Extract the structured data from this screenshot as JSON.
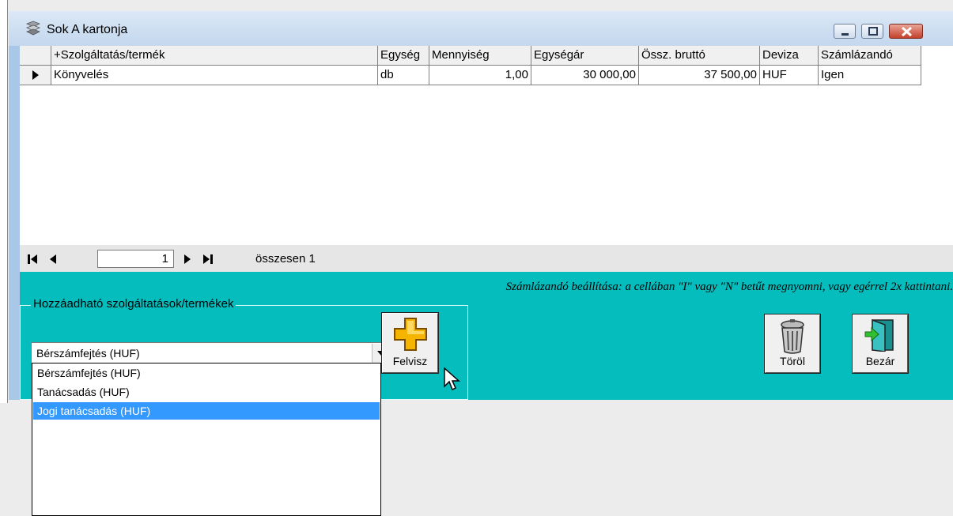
{
  "window": {
    "title": "Sok A kartonja"
  },
  "grid": {
    "columns": [
      "+Szolgáltatás/termék",
      "Egység",
      "Mennyiség",
      "Egységár",
      "Össz. bruttó",
      "Deviza",
      "Számlázandó"
    ],
    "rows": [
      {
        "name": "Könyvelés",
        "unit": "db",
        "qty": "1,00",
        "unit_price": "30 000,00",
        "gross": "37 500,00",
        "currency": "HUF",
        "billable": "Igen"
      }
    ]
  },
  "navigator": {
    "record": "1",
    "total_label": "összesen 1"
  },
  "panel": {
    "hint": "Számlázandó beállítása: a cellában \"I\" vagy \"N\" betűt megnyomni, vagy egérrel 2x kattintani.",
    "group_label": "Hozzáadható szolgáltatások/termékek",
    "combo_value": "Bérszámfejtés (HUF)",
    "options": [
      "Bérszámfejtés (HUF)",
      "Tanácsadás (HUF)",
      "Jogi tanácsadás (HUF)"
    ],
    "selected_option": "Jogi tanácsadás (HUF)"
  },
  "buttons": {
    "add": "Felvisz",
    "delete": "Töröl",
    "close": "Bezár"
  },
  "colors": {
    "panel": "#05bdbd",
    "selection": "#3399ff",
    "title_bar": "#c3d7ee"
  }
}
